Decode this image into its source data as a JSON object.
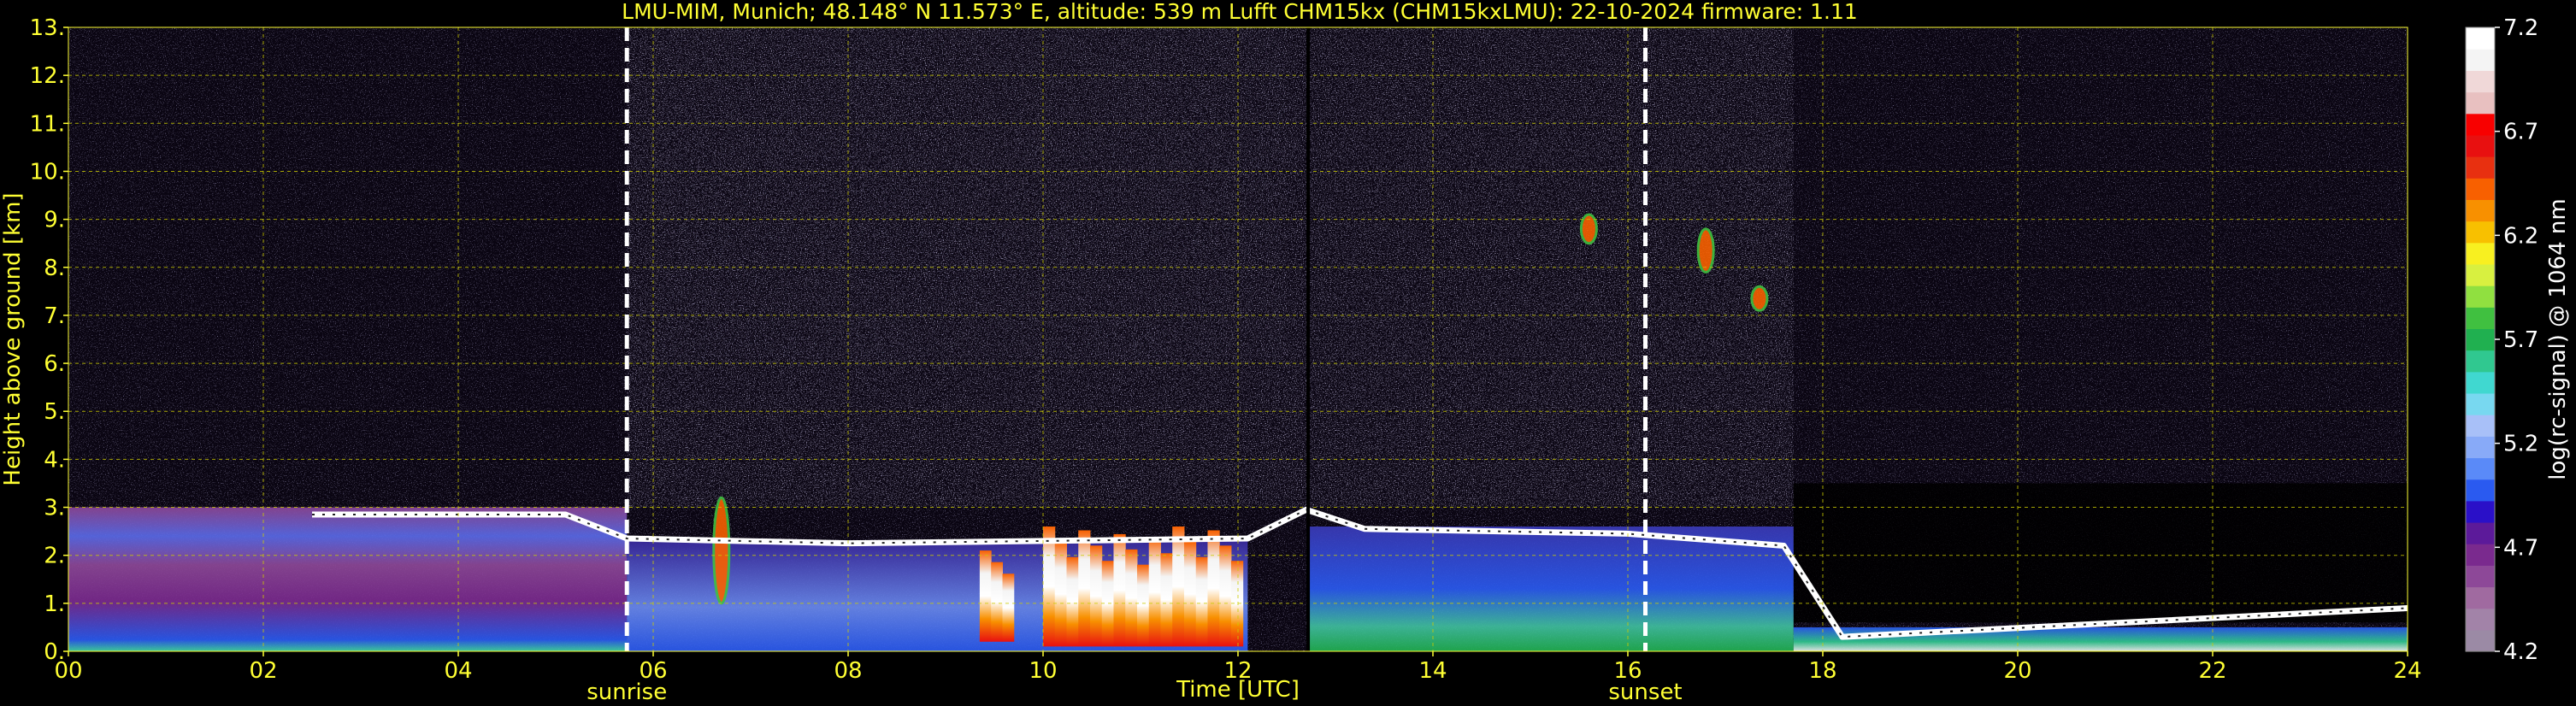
{
  "title": "LMU-MIM, Munich; 48.148° N 11.573° E, altitude: 539 m    Lufft CHM15kx (CHM15kxLMU): 22-10-2024    firmware: 1.11",
  "chart_data": {
    "type": "heatmap",
    "title": "LMU-MIM, Munich; 48.148° N 11.573° E, altitude: 539 m    Lufft CHM15kx (CHM15kxLMU): 22-10-2024    firmware: 1.11",
    "xlabel": "Time [UTC]",
    "ylabel": "Height above ground [km]",
    "xlim": [
      0,
      24
    ],
    "ylim": [
      0,
      13
    ],
    "x_ticks": [
      0,
      2,
      4,
      6,
      8,
      10,
      12,
      14,
      16,
      18,
      20,
      22,
      24
    ],
    "x_tick_labels": [
      "00",
      "02",
      "04",
      "06",
      "08",
      "10",
      "12",
      "14",
      "16",
      "18",
      "20",
      "22",
      "24"
    ],
    "y_ticks": [
      0,
      1,
      2,
      3,
      4,
      5,
      6,
      7,
      8,
      9,
      10,
      11,
      12,
      13
    ],
    "y_tick_labels": [
      "0.",
      "1.",
      "2.",
      "3.",
      "4.",
      "5.",
      "6.",
      "7.",
      "8.",
      "9.",
      "10.",
      "11.",
      "12.",
      "13."
    ],
    "grid": true,
    "events": [
      {
        "label": "sunrise",
        "x": 5.73
      },
      {
        "label": "sunset",
        "x": 16.18
      }
    ],
    "marker_line_x": 12.72,
    "colorbar": {
      "label": "log(rc-signal) @ 1064 nm",
      "min": 4.2,
      "max": 7.2,
      "ticks": [
        4.2,
        4.7,
        5.2,
        5.7,
        6.2,
        6.7,
        7.2
      ],
      "tick_labels": [
        "4.2",
        "4.7",
        "5.2",
        "5.7",
        "6.2",
        "6.7",
        "7.2"
      ],
      "colors": [
        "#9b8aa5",
        "#a283a8",
        "#a06aa0",
        "#8d4898",
        "#7a2a8e",
        "#5c1a9a",
        "#2a10c8",
        "#2a5af0",
        "#5a8af8",
        "#88aaf8",
        "#a8c0f8",
        "#78d8f0",
        "#40d8d0",
        "#30c890",
        "#20b050",
        "#40c040",
        "#90e040",
        "#d8f040",
        "#f8f020",
        "#f8c000",
        "#f89000",
        "#f86000",
        "#e83010",
        "#e81010",
        "#f80000",
        "#e8c0c0",
        "#f0d8d8",
        "#f4f4f4",
        "#ffffff"
      ]
    },
    "layers": [
      {
        "x_start": 0.0,
        "x_end": 5.73,
        "y_bottom": 0.0,
        "y_top": 3.0,
        "level": 4.75
      },
      {
        "x_start": 5.73,
        "x_end": 12.1,
        "y_bottom": 0.0,
        "y_top": 2.3,
        "level": 5.1
      },
      {
        "x_start": 12.72,
        "x_end": 17.7,
        "y_bottom": 0.0,
        "y_top": 2.6,
        "level": 5.0
      },
      {
        "x_start": 17.7,
        "x_end": 24.0,
        "y_bottom": 0.0,
        "y_top": 0.5,
        "level": 5.4
      }
    ],
    "cloud_top": [
      {
        "x": 2.5,
        "y": 2.85
      },
      {
        "x": 5.1,
        "y": 2.85
      },
      {
        "x": 5.73,
        "y": 2.35
      },
      {
        "x": 8.0,
        "y": 2.25
      },
      {
        "x": 12.1,
        "y": 2.35
      },
      {
        "x": 12.7,
        "y": 2.95
      },
      {
        "x": 13.3,
        "y": 2.55
      },
      {
        "x": 16.0,
        "y": 2.45
      },
      {
        "x": 17.6,
        "y": 2.2
      },
      {
        "x": 18.2,
        "y": 0.3
      },
      {
        "x": 24.0,
        "y": 0.9
      }
    ],
    "strong_echoes": [
      {
        "x_start": 9.35,
        "x_end": 9.7,
        "y_bottom": 0.2,
        "y_top": 2.1
      },
      {
        "x_start": 10.0,
        "x_end": 12.05,
        "y_bottom": 0.1,
        "y_top": 2.6
      }
    ],
    "cirrus": [
      {
        "x": 6.7,
        "y_bottom": 1.0,
        "y_top": 3.2
      },
      {
        "x": 15.6,
        "y_bottom": 8.5,
        "y_top": 9.1
      },
      {
        "x": 16.8,
        "y_bottom": 7.9,
        "y_top": 8.8
      },
      {
        "x": 17.35,
        "y_bottom": 7.1,
        "y_top": 7.6
      }
    ]
  }
}
